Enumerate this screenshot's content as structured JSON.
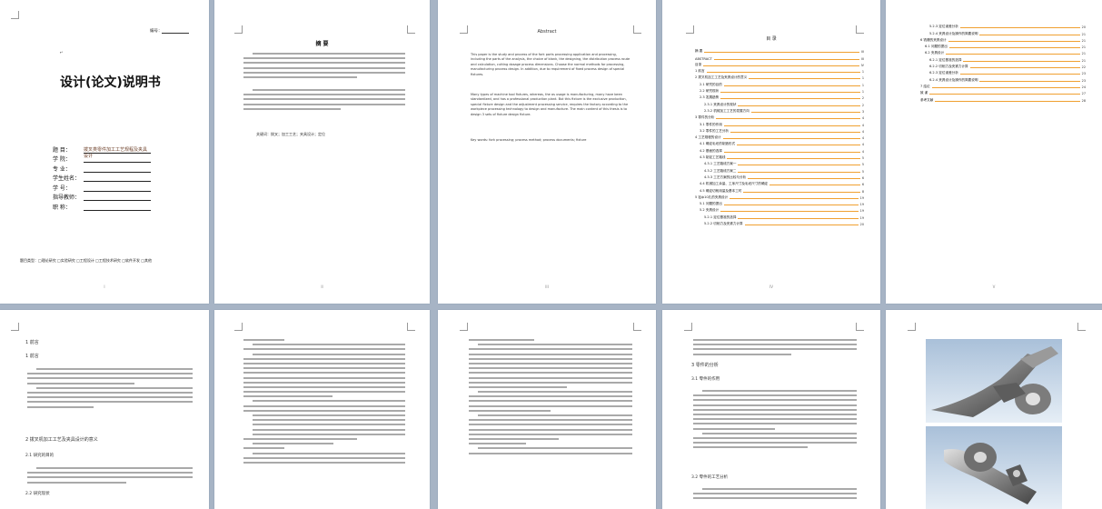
{
  "cover": {
    "number_label": "编号：",
    "title": "设计(论文)说明书",
    "return_mark": "↵",
    "fields": [
      {
        "label": "题    目：",
        "value": "拨叉类零件加工工艺规程及夹具设计"
      },
      {
        "label": "学    院：",
        "value": ""
      },
      {
        "label": "专    业：",
        "value": ""
      },
      {
        "label": "学生姓名：",
        "value": ""
      },
      {
        "label": "学    号：",
        "value": ""
      },
      {
        "label": "指导教师：",
        "value": ""
      },
      {
        "label": "职    称：",
        "value": ""
      }
    ],
    "footer_note": "题目类型：□理论研究 □实验研究 □工程设计 □工程技术研究 □软件开发 □其他"
  },
  "cn_abstract": {
    "title": "摘    要",
    "keywords": "关键词：拨叉；加工工艺；夹具设计；定位"
  },
  "en_abstract": {
    "title": "Abstract",
    "paragraphs": [
      "This paper is the study and process of the fork parts processing application and processing, including the parts of the analysis, the choice of blank, the designing, the distribution process route and calculation, cutting dosage process dimensions. Choose the normal methods for processing, manufacturing process design. In addition, due to requirement of fixed process design of special fixtures.",
      "Many types of machine tool fixtures, whereas, the as usage is manufacturing, many have been standardized, and has a professional production plant. But this fixture is the exclusive production, special fixture design and the adjustment processing service, requires the factory according to the workpiece processing technology to design and manufacture. The main content of this thesis is to design 3 sets of fixture design fixture."
    ],
    "keywords": "Key words: fork processing; process method; process documents; fixture"
  },
  "toc": {
    "title": "目    录",
    "rows": [
      {
        "label": "摘    要",
        "page": "III"
      },
      {
        "label": "ABSTRACT",
        "page": "III"
      },
      {
        "label": "目录",
        "page": "IV"
      },
      {
        "label": "1 前言",
        "page": "1"
      },
      {
        "label": "2 拨叉机加工工艺及夹具设计的意义",
        "page": "1"
      },
      {
        "label": "2.1 研究的目的",
        "page": "1"
      },
      {
        "label": "2.2 研究现状",
        "page": "1"
      },
      {
        "label": "2.3 发展趋势",
        "page": "2"
      },
      {
        "label": "2.3.1 夹具设计的现状",
        "page": "2"
      },
      {
        "label": "2.3.2 机械加工工艺的发展方向",
        "page": "3"
      },
      {
        "label": "3 零件的分析",
        "page": "4"
      },
      {
        "label": "3.1 零件的作用",
        "page": "4"
      },
      {
        "label": "3.2 零件的工艺分析",
        "page": "4"
      },
      {
        "label": "4 工艺规程的设计",
        "page": "4"
      },
      {
        "label": "4.1 确定毛坯的制造形式",
        "page": "4"
      },
      {
        "label": "4.2 基面的选择",
        "page": "4"
      },
      {
        "label": "4.3 制定工艺路线",
        "page": "5"
      },
      {
        "label": "4.3.1 工艺路线方案一",
        "page": "5"
      },
      {
        "label": "4.3.2 工艺路线方案二",
        "page": "5"
      },
      {
        "label": "4.3.3 工艺方案的比较与分析",
        "page": "6"
      },
      {
        "label": "4.4 机械加工余量、工序尺寸及毛坯尺寸的确定",
        "page": "6"
      },
      {
        "label": "4.5 确定切削用量及基本工时",
        "page": "8"
      },
      {
        "label": "5 钻ф10孔的夹具设计",
        "page": "19"
      },
      {
        "label": "5.1 问题的提出",
        "page": "19"
      },
      {
        "label": "5.2 夹具设计",
        "page": "19"
      },
      {
        "label": "5.2.1 定位基准的选择",
        "page": "19"
      },
      {
        "label": "5.2.2 切削力及夹紧力计算",
        "page": "20"
      }
    ],
    "rows2": [
      {
        "label": "5.2.3 定位误差分析",
        "page": "20"
      },
      {
        "label": "5.2.4 夹具设计及操作的简要说明",
        "page": "21"
      },
      {
        "label": "6 铣槽的夹具设计",
        "page": "21"
      },
      {
        "label": "6.1 问题的提出",
        "page": "21"
      },
      {
        "label": "6.2 夹具设计",
        "page": "21"
      },
      {
        "label": "6.2.1 定位基准的选择",
        "page": "21"
      },
      {
        "label": "6.2.2 切削力及夹紧力计算",
        "page": "22"
      },
      {
        "label": "6.2.3 定位误差分析",
        "page": "23"
      },
      {
        "label": "6.2.4 夹具设计及操作的简要说明",
        "page": "23"
      },
      {
        "label": "7 结论",
        "page": "24"
      },
      {
        "label": "致    谢",
        "page": "27"
      },
      {
        "label": "参考文献",
        "page": "28"
      }
    ]
  },
  "body_pages": {
    "p6_heading1": "1 前言",
    "p6_heading2": "2 拨叉机加工工艺及夹具设计的意义",
    "p6_heading3": "2.1 研究的目的",
    "p6_heading4": "2.2 研究现状",
    "p9_heading1": "3 零件的分析",
    "p9_heading2": "3.1 零件的作用",
    "p9_heading3": "3.2 零件的工艺分析"
  },
  "page_numbers": {
    "p1": "I",
    "p2": "II",
    "p3": "III",
    "p4": "IV",
    "p5": "V"
  },
  "colors": {
    "background": "#a7b4c5",
    "page": "#ffffff",
    "leader": "#f0a030",
    "heading_text": "#111111"
  }
}
